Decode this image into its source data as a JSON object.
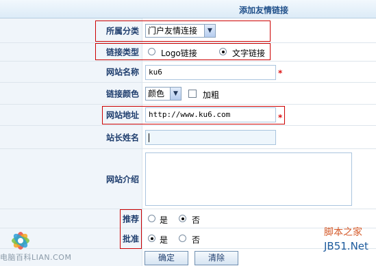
{
  "header": {
    "title": "添加友情链接"
  },
  "form": {
    "category": {
      "label": "所属分类",
      "value": "门户友情连接"
    },
    "link_type": {
      "label": "链接类型",
      "options": [
        "Logo链接",
        "文字链接"
      ],
      "selected": "文字链接"
    },
    "site_name": {
      "label": "网站名称",
      "value": "ku6",
      "required_mark": "*"
    },
    "link_color": {
      "label": "链接颜色",
      "value": "颜色",
      "bold_label": "加粗",
      "bold_checked": false
    },
    "site_url": {
      "label": "网站地址",
      "value": "http://www.ku6.com",
      "required_mark": "*"
    },
    "owner_name": {
      "label": "站长姓名",
      "value": ""
    },
    "site_intro": {
      "label": "网站介绍",
      "value": ""
    },
    "recommend": {
      "label": "推荐",
      "options": [
        "是",
        "否"
      ],
      "selected": "否"
    },
    "approve": {
      "label": "批准",
      "options": [
        "是",
        "否"
      ],
      "selected": "是"
    }
  },
  "buttons": {
    "confirm": "确定",
    "clear": "清除"
  },
  "watermarks": {
    "left": "电脑百科",
    "left_partial": "LIAN.COM",
    "right_top": "脚本之家",
    "right_bottom": "JB51.Net"
  },
  "colors": {
    "label_text": "#1f3e6e",
    "label_bg": "#f0f5fa",
    "highlight": "#cc0000",
    "required": "#dd1111"
  }
}
